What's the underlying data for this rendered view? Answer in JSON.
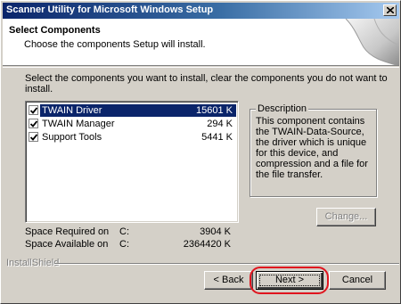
{
  "window": {
    "title": "Scanner Utility for Microsoft Windows Setup"
  },
  "header": {
    "title": "Select Components",
    "subtitle": "Choose the components Setup will install."
  },
  "instruction": "Select the components you want to install, clear the components you do not want to install.",
  "components": [
    {
      "label": "TWAIN Driver",
      "size": "15601 K",
      "checked": true,
      "selected": true
    },
    {
      "label": "TWAIN Manager",
      "size": "294 K",
      "checked": true,
      "selected": false
    },
    {
      "label": "Support Tools",
      "size": "5441 K",
      "checked": true,
      "selected": false
    }
  ],
  "description": {
    "legend": "Description",
    "text": "This component contains the TWAIN-Data-Source, the driver which is unique for this device, and compression and a file for the file transfer."
  },
  "buttons": {
    "change": "Change...",
    "back": "< Back",
    "next": "Next >",
    "cancel": "Cancel"
  },
  "space": {
    "required_label": "Space Required on",
    "required_drive": "C:",
    "required_value": "3904 K",
    "available_label": "Space Available on",
    "available_drive": "C:",
    "available_value": "2364420 K"
  },
  "footer": {
    "brand": "InstallShield"
  },
  "colors": {
    "highlight": "#e0141e",
    "selection": "#0a246a"
  }
}
